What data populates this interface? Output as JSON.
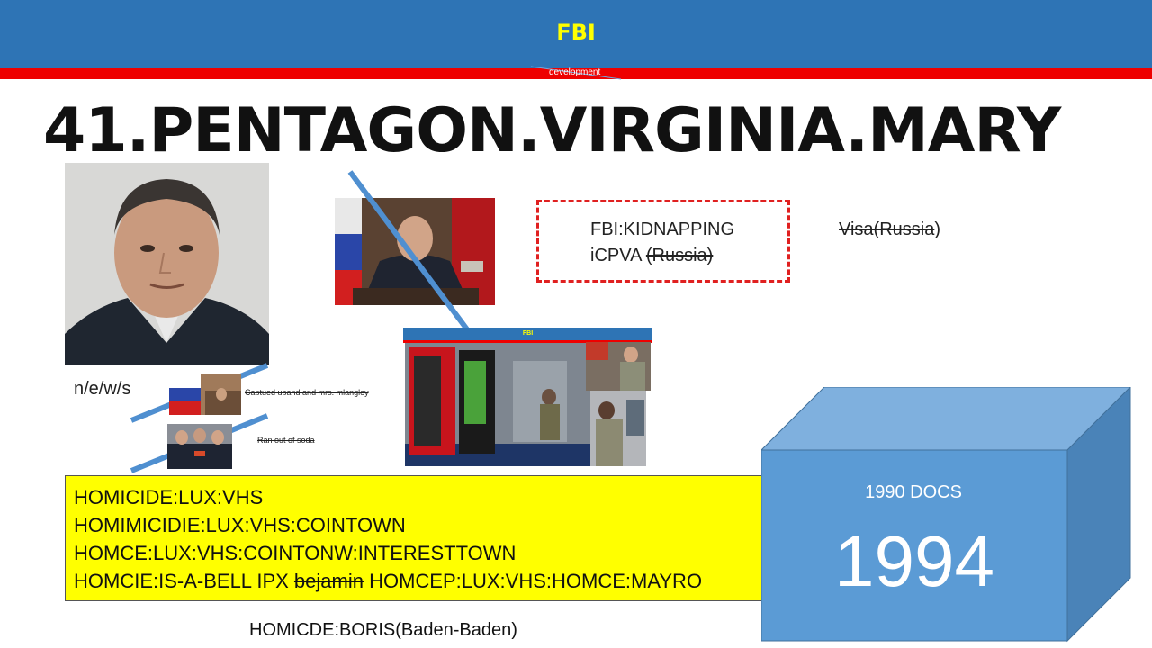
{
  "header": {
    "title": "FBI",
    "subtitle": "development"
  },
  "title": "41.PENTAGON.VIRGINIA.MARY",
  "kidnapping_box": {
    "line1": "FBI:KIDNAPPING",
    "line2_prefix": "iCPVA ",
    "line2_struck": "(Russia)"
  },
  "visa": {
    "struck": "Visa(Russia",
    "tail": ")"
  },
  "directions": "n/e/w/s",
  "captions": {
    "caption1": "Captued uband and mrs. mlangley",
    "caption2": "Ran out of soda"
  },
  "fbi_panel": {
    "banner": "FBI"
  },
  "homicide_box": {
    "lines": [
      "HOMICIDE:LUX:VHS",
      "HOMIMICIDIE:LUX:VHS:COINTOWN",
      "HOMCE:LUX:VHS:COINTONW:INTERESTTOWN"
    ],
    "last_line": {
      "prefix": "HOMCIE:IS-A-BELL IPX ",
      "struck": "bejamin",
      "suffix": " HOMCEP:LUX:VHS:HOMCE:MAYRO"
    }
  },
  "footer_text": "HOMICDE:BORIS(Baden-Baden)",
  "cube": {
    "label": "1990 DOCS",
    "year": "1994"
  },
  "colors": {
    "header_blue": "#2e74b5",
    "header_red": "#ee0000",
    "header_title": "#ffff00",
    "highlight_yellow": "#ffff00",
    "dashed_border": "#e02020",
    "cube_front": "#5b9bd5",
    "cube_top": "#7fb0de",
    "cube_side": "#4a83b8",
    "strike_line": "#4f8fd0"
  },
  "icons": {
    "portrait": "portrait-photo",
    "speaker": "speaker-photo",
    "flags": "flags-photo",
    "group": "group-photo",
    "vending": "vending-machine-photo",
    "soldier": "soldier-photo"
  }
}
